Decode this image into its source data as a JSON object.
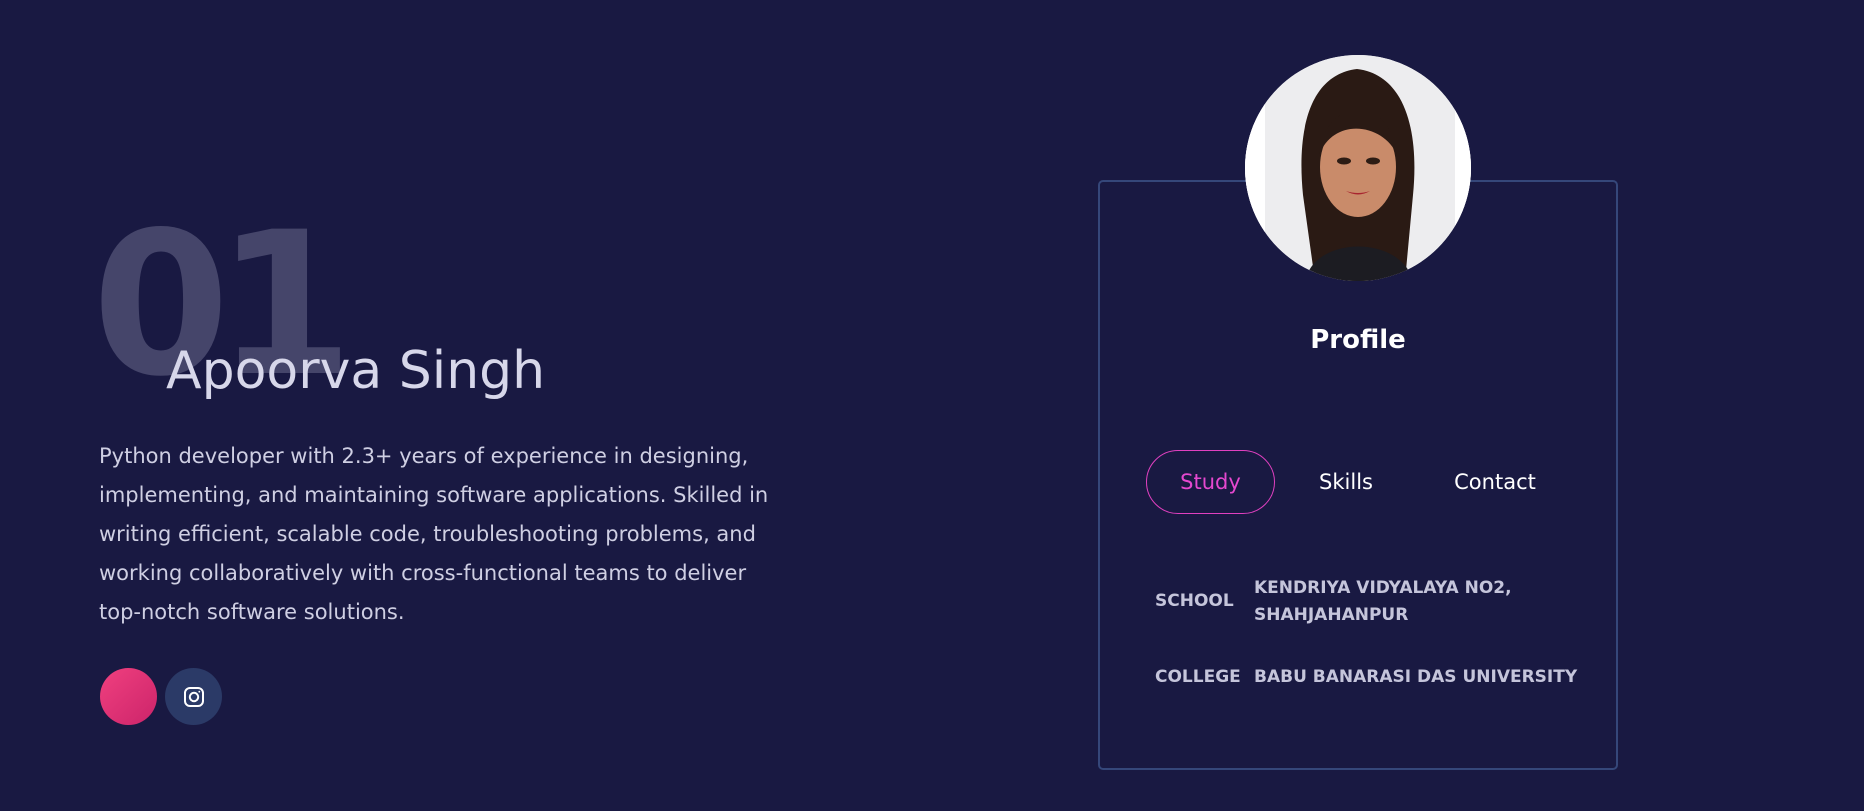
{
  "hero": {
    "number": "01",
    "name": "Apoorva Singh",
    "bio": "Python developer with 2.3+ years of experience in designing, implementing, and maintaining software applications. Skilled in writing efficient, scalable code, troubleshooting problems, and working collaboratively with cross-functional teams to deliver top-notch software solutions."
  },
  "socials": [
    {
      "icon": "pink-circle-icon"
    },
    {
      "icon": "instagram-icon"
    }
  ],
  "profile": {
    "title": "Profile",
    "tabs": [
      "Study",
      "Skills",
      "Contact"
    ],
    "active_tab": "Study",
    "rows": [
      {
        "label": "SCHOOL",
        "value_line1": "KENDRIYA VIDYALAYA NO2,",
        "value_line2": "SHAHJAHANPUR"
      },
      {
        "label": "COLLEGE",
        "value_line1": "BABU BANARASI DAS UNIVERSITY"
      }
    ]
  },
  "colors": {
    "background": "#191942",
    "accent": "#e548cf",
    "card_border": "#35477a",
    "big_number": "#45456a"
  }
}
